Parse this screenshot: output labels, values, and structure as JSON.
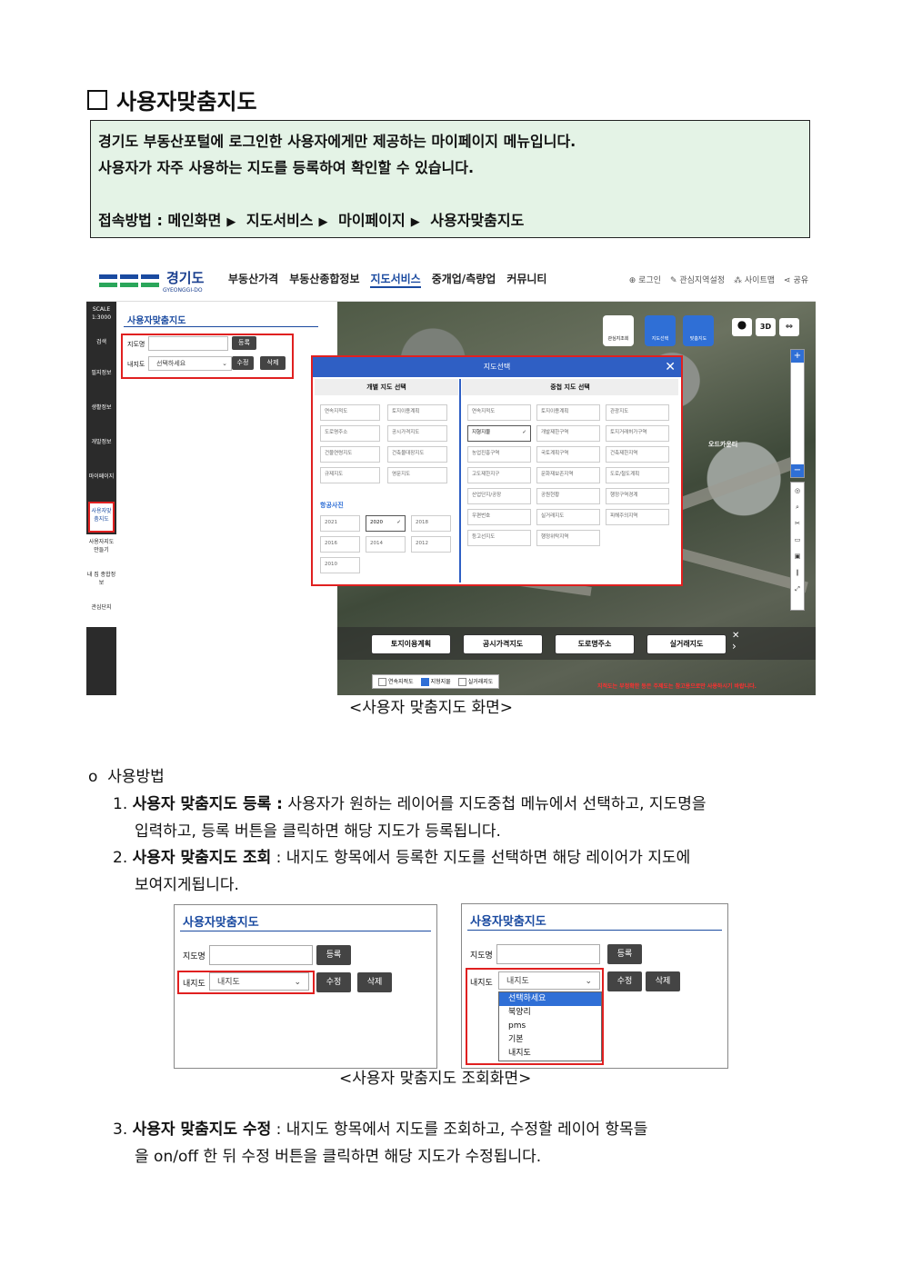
{
  "heading": {
    "title": "사용자맞춤지도"
  },
  "intro": {
    "line1": "경기도 부동산포털에 로그인한 사용자에게만 제공하는 마이페이지 메뉴입니다.",
    "line2": "사용자가 자주 사용하는 지도를 등록하여 확인할 수 있습니다.",
    "access_label": "접속방법 :",
    "path": [
      "메인화면",
      "지도서비스",
      "마이페이지",
      "사용자맞춤지도"
    ]
  },
  "screenshot1": {
    "logo_name": "경기도",
    "logo_sub": "GYEONGGI-DO",
    "nav": [
      "부동산가격",
      "부동산종합정보",
      "지도서비스",
      "중개업/측량업",
      "커뮤니티"
    ],
    "util": [
      "로그인",
      "관심지역설정",
      "사이트맵",
      "공유"
    ],
    "leftnav": [
      "SCALE 1:3000",
      "검색",
      "필지정보",
      "생활정보",
      "개발정보",
      "마이페이지",
      "사용자맞춤지도",
      "사용자지도만들기",
      "내 집 종합정보",
      "관심단지"
    ],
    "panel_title": "사용자맞춤지도",
    "map_name_label": "지도명",
    "register_btn": "등록",
    "my_map_label": "내지도",
    "select_value": "선택하세요",
    "edit_btn": "수정",
    "delete_btn": "삭제",
    "dialog_title": "지도선택",
    "dialog_close": "✕",
    "col_single": "개별 지도 선택",
    "col_overlay": "중첩 지도 선택",
    "single_opts": [
      "연속지적도",
      "토지이용계획",
      "도로명주소",
      "공시가격지도",
      "건물연령지도",
      "건축물대장지도",
      "규제지도",
      "영문지도"
    ],
    "aerial_label": "항공사진",
    "years": [
      "2021",
      "2020",
      "2018",
      "2016",
      "2014",
      "2012",
      "2010"
    ],
    "overlay_opts": [
      "연속지적도",
      "토지이용계획",
      "관광지도",
      "지형지물",
      "개발제한구역",
      "토지거래허가구역",
      "농업진흥구역",
      "국토계획구역",
      "건축제한지역",
      "고도제한지구",
      "문화재보존지역",
      "도로/철도계획",
      "산업단지/공장",
      "공원현황",
      "행정구역경계",
      "우편번호",
      "실거래지도",
      "피해주의지역",
      "등고선지도",
      "행정위탁지역"
    ],
    "map_tools": [
      "관심지조회",
      "지도선택",
      "맞춤지도"
    ],
    "map_btns": [
      "3D"
    ],
    "map_place": "오드카운티",
    "chips": [
      "토지이용계획",
      "공시가격지도",
      "도로명주소",
      "실거래지도"
    ],
    "chkbar": [
      "연속지적도",
      "지형지물",
      "실거래지도"
    ],
    "warning": "지적도는 부정확한 등은 주제도는 참고용으로만 사용하시기 바랍니다."
  },
  "caption1": "<사용자 맞춤지도 화면>",
  "usage": {
    "heading": "사용방법",
    "items": [
      {
        "num": "1.",
        "bold": "사용자 맞춤지도 등록 :",
        "text1": " 사용자가 원하는 레이어를 지도중첩 메뉴에서 선택하고, 지도명을",
        "text2": "입력하고, 등록 버튼을 클릭하면 해당 지도가 등록됩니다."
      },
      {
        "num": "2.",
        "bold": "사용자 맞춤지도 조회",
        "text1": " : 내지도 항목에서 등록한 지도를 선택하면 해당 레이어가 지도에",
        "text2": "보여지게됩니다."
      }
    ]
  },
  "screenshot2": {
    "title": "사용자맞춤지도",
    "map_name_label": "지도명",
    "register_btn": "등록",
    "my_map_label": "내지도",
    "select_value": "내지도",
    "edit_btn": "수정",
    "delete_btn": "삭제"
  },
  "screenshot3": {
    "title": "사용자맞춤지도",
    "map_name_label": "지도명",
    "register_btn": "등록",
    "my_map_label": "내지도",
    "select_value": "내지도",
    "edit_btn": "수정",
    "delete_btn": "삭제",
    "dropdown": [
      "선택하세요",
      "북양리",
      "pms",
      "기본",
      "내지도"
    ]
  },
  "caption2": "<사용자 맞춤지도 조회화면>",
  "item3": {
    "num": "3.",
    "bold": "사용자 맞춤지도 수정",
    "text1": " : 내지도 항목에서 지도를 조회하고, 수정할 레이어 항목들",
    "text2": "을 on/off 한 뒤 수정 버튼을 클릭하면 해당 지도가 수정됩니다."
  }
}
